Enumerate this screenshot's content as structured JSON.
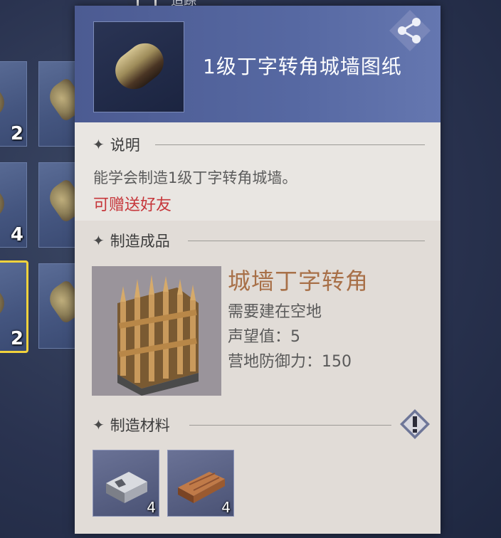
{
  "top_tab": {
    "label": "追踪"
  },
  "inventory": {
    "slots": [
      {
        "count": "2"
      },
      {
        "count": ""
      },
      {
        "count": "4"
      },
      {
        "count": ""
      },
      {
        "count": "2"
      },
      {
        "count": ""
      }
    ],
    "selected_index": 4,
    "selected_border_color": "#f2d23c"
  },
  "item": {
    "title": "1级丁字转角城墙图纸",
    "icon": "blueprint-scroll",
    "share_icon": "share-icon"
  },
  "description": {
    "header": "说明",
    "text": "能学会制造1级丁字转角城墙。",
    "gift_text": "可赠送好友"
  },
  "product": {
    "header": "制造成品",
    "name": "城墙丁字转角",
    "attributes": [
      "需要建在空地",
      "声望值：5",
      "营地防御力：150"
    ]
  },
  "materials": {
    "header": "制造材料",
    "items": [
      {
        "icon": "iron-ingot-icon",
        "count": "4"
      },
      {
        "icon": "wood-plank-icon",
        "count": "4"
      }
    ]
  },
  "colors": {
    "panel_bg": "#e9e6e2",
    "header_bg": "#5668a2",
    "gift_red": "#c6363a",
    "product_name_brown": "#a87048"
  }
}
